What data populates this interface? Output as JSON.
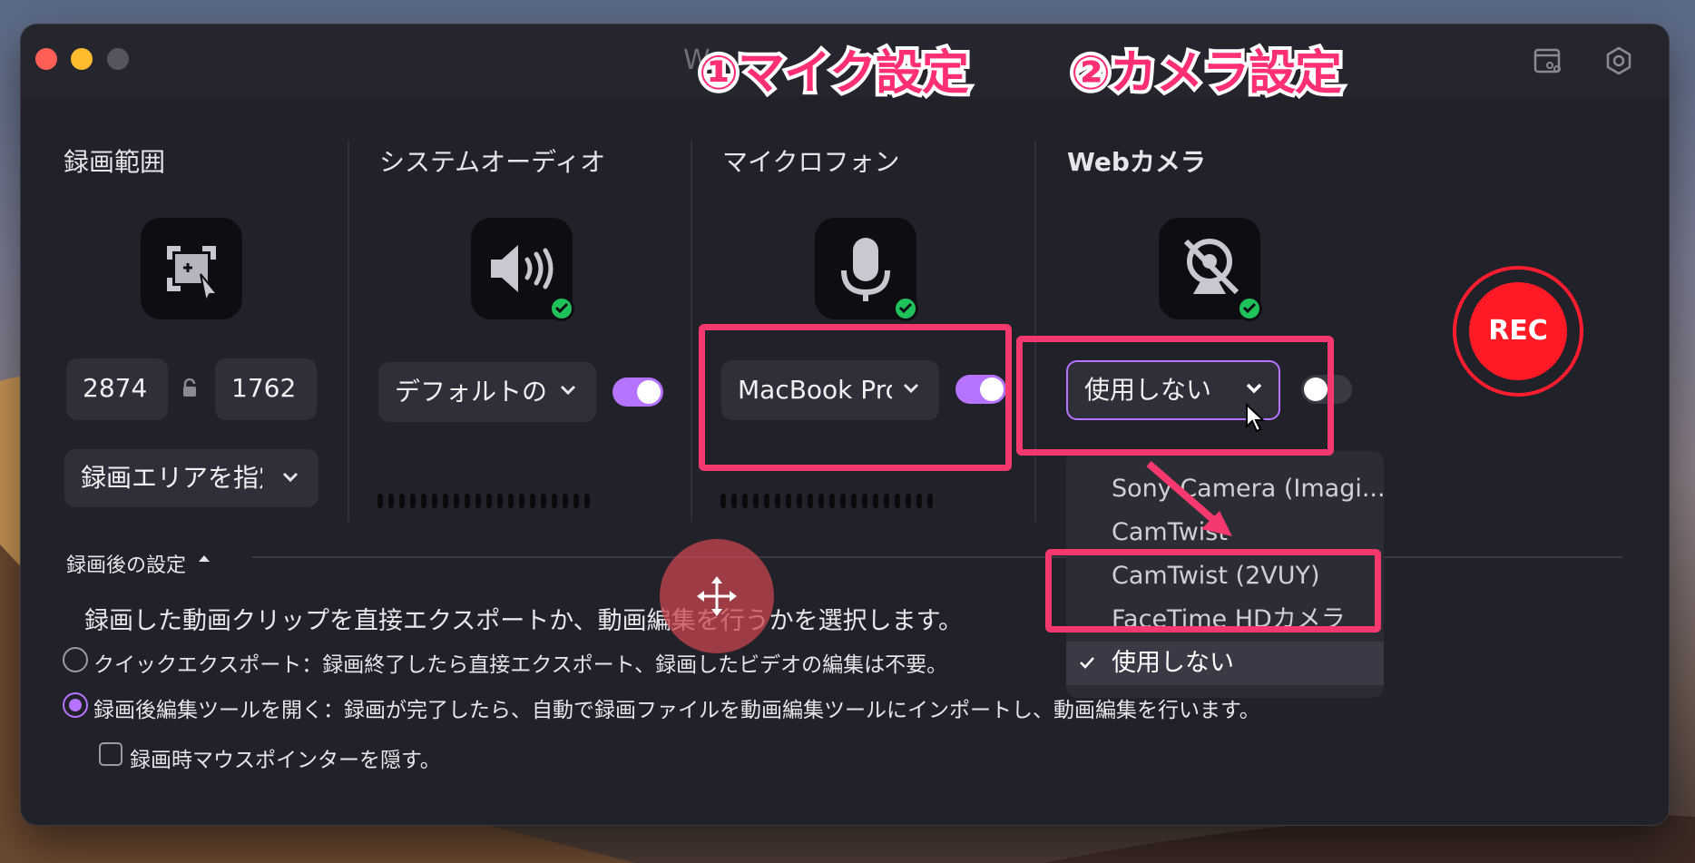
{
  "window": {
    "title": "We",
    "colors": {
      "close": "#ff5f57",
      "minimize": "#febc2e",
      "zoom": "#55555d"
    }
  },
  "annotations": {
    "mic_setting": "①マイク設定",
    "camera_setting": "②カメラ設定"
  },
  "sections": {
    "recording_area": {
      "title": "録画範囲",
      "icon": "screen-select-icon",
      "width": "2874",
      "height": "1762",
      "lock_icon": "lock-open-icon",
      "area_select_label": "録画エリアを指定"
    },
    "system_audio": {
      "title": "システムオーディオ",
      "icon": "speaker-icon",
      "status": "enabled-check",
      "device_label": "デフォルトの出",
      "toggle_on": true
    },
    "microphone": {
      "title": "マイクロフォン",
      "icon": "microphone-icon",
      "status": "enabled-check",
      "device_label": "MacBook Pro",
      "toggle_on": true
    },
    "webcam": {
      "title": "Webカメラ",
      "icon": "camera-off-icon",
      "status": "enabled-check",
      "device_label": "使用しない",
      "toggle_on": false,
      "options": [
        "Sony Camera (Imagi...",
        "CamTwist",
        "CamTwist (2VUY)",
        "FaceTime HDカメラ",
        "使用しない"
      ],
      "selected_option": "使用しない"
    }
  },
  "rec_button": {
    "label": "REC",
    "color": "#ff1a26"
  },
  "after_recording": {
    "label": "録画後の設定",
    "description": "録画した動画クリップを直接エクスポートか、動画編集を行うかを選択します。",
    "options": [
      {
        "label": "クイックエクスポート：録画終了したら直接エクスポート、録画したビデオの編集は不要。",
        "selected": false
      },
      {
        "label": "録画後編集ツールを開く：録画が完了したら、自動で録画ファイルを動画編集ツールにインポートし、動画編集を行います。",
        "selected": true
      }
    ],
    "hide_pointer_label": "録画時マウスポインターを隠す。"
  },
  "accent_color": "#b673ff",
  "highlight_color": "#f5396e"
}
